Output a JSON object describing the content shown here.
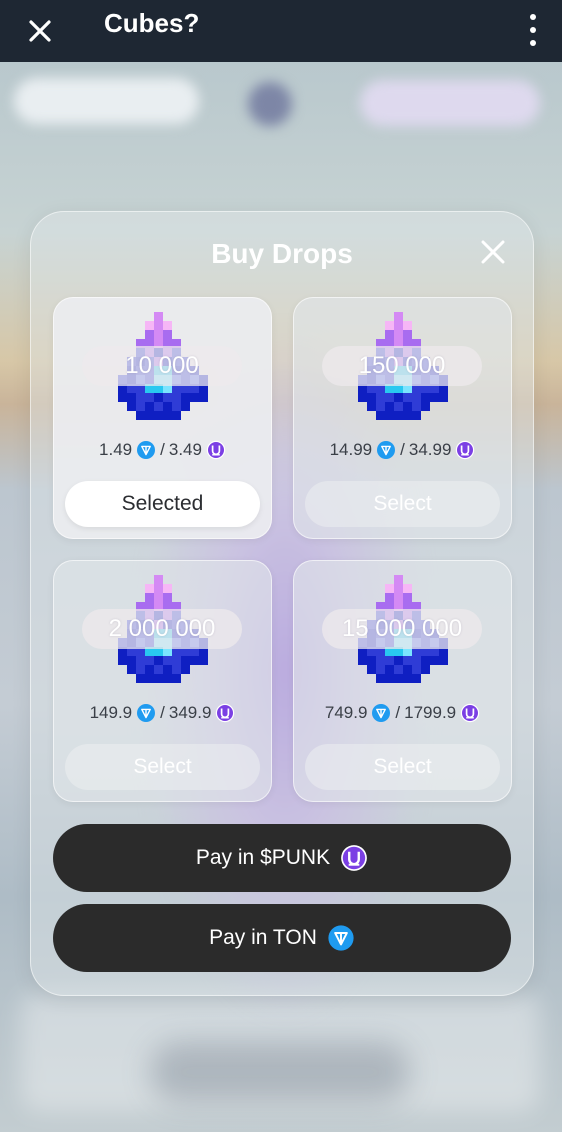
{
  "app": {
    "title": "Cubes?"
  },
  "modal": {
    "title": "Buy Drops"
  },
  "packs": [
    {
      "amount": "10 000",
      "ton_price": "1.49",
      "punk_price": "3.49",
      "button": "Selected",
      "selected": true
    },
    {
      "amount": "150 000",
      "ton_price": "14.99",
      "punk_price": "34.99",
      "button": "Select",
      "selected": false
    },
    {
      "amount": "2 000 000",
      "ton_price": "149.9",
      "punk_price": "349.9",
      "button": "Select",
      "selected": false
    },
    {
      "amount": "15 000 000",
      "ton_price": "749.9",
      "punk_price": "1799.9",
      "button": "Select",
      "selected": false
    }
  ],
  "price_separator": "/",
  "pay": {
    "punk_label": "Pay in $PUNK",
    "ton_label": "Pay in TON"
  },
  "icons": {
    "close": "close-icon",
    "menu": "more-vertical-icon",
    "drop": "pixel-drop-icon",
    "ton": "ton-coin-icon",
    "punk": "punk-coin-icon"
  },
  "colors": {
    "topbar": "#1e2733",
    "ton": "#1f9bf0",
    "punk": "#7b3fe4",
    "pay_button": "#2b2b2b"
  }
}
